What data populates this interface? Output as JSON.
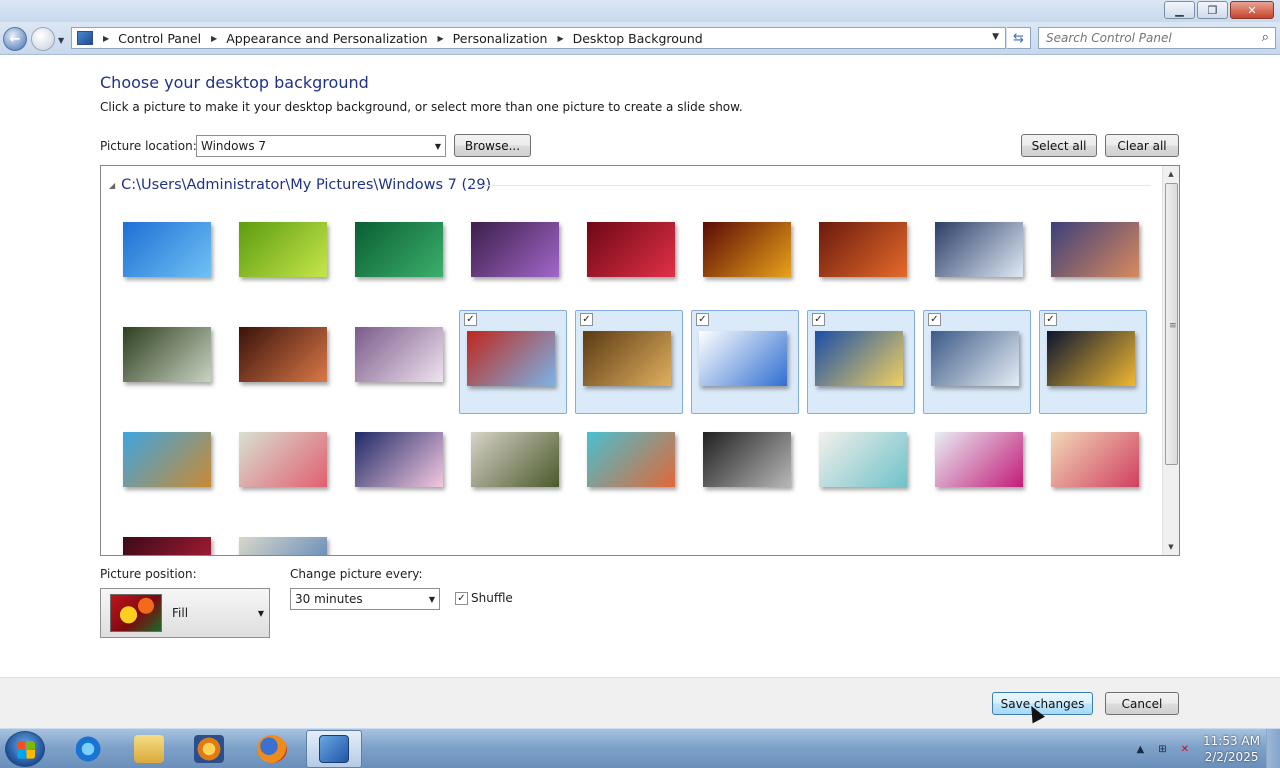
{
  "window": {
    "caption_buttons": [
      "minimize-icon",
      "maximize-icon",
      "close-icon"
    ]
  },
  "nav": {
    "breadcrumbs": [
      "Control Panel",
      "Appearance and Personalization",
      "Personalization",
      "Desktop Background"
    ],
    "search_placeholder": "Search Control Panel"
  },
  "page": {
    "title": "Choose your desktop background",
    "subtitle": "Click a picture to make it your desktop background, or select more than one picture to create a slide show.",
    "picture_location_label": "Picture location:",
    "picture_location_value": "Windows 7",
    "browse_label": "Browse...",
    "select_all_label": "Select all",
    "clear_all_label": "Clear all"
  },
  "gallery": {
    "group_header": "C:\\Users\\Administrator\\My Pictures\\Windows 7 (29)",
    "thumbnails": [
      {
        "subject": "windows-logo",
        "colors": [
          "#1e6fd4",
          "#6fc2f4"
        ],
        "selected": false
      },
      {
        "subject": "green-leaves",
        "colors": [
          "#5c9c10",
          "#c6e64a"
        ],
        "selected": false
      },
      {
        "subject": "green-plant",
        "colors": [
          "#0b5e33",
          "#3ab06a"
        ],
        "selected": false
      },
      {
        "subject": "purple-thistle",
        "colors": [
          "#3a1f4a",
          "#a366c9"
        ],
        "selected": false
      },
      {
        "subject": "red-dahlia",
        "colors": [
          "#6e0814",
          "#e13048"
        ],
        "selected": false
      },
      {
        "subject": "autumn-leaves",
        "colors": [
          "#5a0a06",
          "#e8a21a"
        ],
        "selected": false
      },
      {
        "subject": "canyon",
        "colors": [
          "#6b1a0d",
          "#e46a2a"
        ],
        "selected": false
      },
      {
        "subject": "ice-lake",
        "colors": [
          "#2c3e66",
          "#dfe9f5"
        ],
        "selected": false
      },
      {
        "subject": "rocky-coast",
        "colors": [
          "#3b3f7a",
          "#d98a5e"
        ],
        "selected": false
      },
      {
        "subject": "waterfall",
        "colors": [
          "#2e3f1f",
          "#c8d3c2"
        ],
        "selected": false
      },
      {
        "subject": "rock-arch",
        "colors": [
          "#3a120a",
          "#d97848"
        ],
        "selected": false
      },
      {
        "subject": "lavender-field",
        "colors": [
          "#7a5a8a",
          "#efe3ee"
        ],
        "selected": false
      },
      {
        "subject": "tower-sunset",
        "colors": [
          "#c0261c",
          "#7ab4e8"
        ],
        "selected": true
      },
      {
        "subject": "wood-curves",
        "colors": [
          "#5a3a12",
          "#e0b060"
        ],
        "selected": true
      },
      {
        "subject": "white-building",
        "colors": [
          "#ffffff",
          "#2f6fd0"
        ],
        "selected": true
      },
      {
        "subject": "glass-roof",
        "colors": [
          "#1a4ea8",
          "#f0d060"
        ],
        "selected": true
      },
      {
        "subject": "dotted-facade",
        "colors": [
          "#3b5a86",
          "#e6edf5"
        ],
        "selected": true
      },
      {
        "subject": "bridge-night",
        "colors": [
          "#0b1530",
          "#f0b830"
        ],
        "selected": true
      },
      {
        "subject": "flying-island",
        "colors": [
          "#3da6e0",
          "#c98a32"
        ],
        "selected": false
      },
      {
        "subject": "floral-art",
        "colors": [
          "#d8e0d2",
          "#e06070"
        ],
        "selected": false
      },
      {
        "subject": "cartoon-face",
        "colors": [
          "#1e2a66",
          "#f4c8e0"
        ],
        "selected": false
      },
      {
        "subject": "robot-figure",
        "colors": [
          "#d8d2c8",
          "#4a5a2a"
        ],
        "selected": false
      },
      {
        "subject": "whimsical-town",
        "colors": [
          "#48c0d0",
          "#e06838"
        ],
        "selected": false
      },
      {
        "subject": "gray-creatures",
        "colors": [
          "#202020",
          "#b8b8b8"
        ],
        "selected": false
      },
      {
        "subject": "pastel-tree",
        "colors": [
          "#f2f0ec",
          "#6fc2c8"
        ],
        "selected": false
      },
      {
        "subject": "crystal-flowers",
        "colors": [
          "#e8eef4",
          "#c21c78"
        ],
        "selected": false
      },
      {
        "subject": "fantasy-bloom",
        "colors": [
          "#f2d8b8",
          "#d04060"
        ],
        "selected": false
      },
      {
        "subject": "dark-bloom",
        "colors": [
          "#3a0a1a",
          "#c0203a"
        ],
        "selected": false
      },
      {
        "subject": "blue-flowers",
        "colors": [
          "#d8d8c8",
          "#4a78b8"
        ],
        "selected": false
      }
    ]
  },
  "controls": {
    "position_label": "Picture position:",
    "position_value": "Fill",
    "change_label": "Change picture every:",
    "change_value": "30 minutes",
    "shuffle_label": "Shuffle",
    "shuffle_checked": true
  },
  "footer": {
    "save_label": "Save changes",
    "cancel_label": "Cancel"
  },
  "taskbar": {
    "apps": [
      "internet-explorer-icon",
      "file-explorer-icon",
      "media-player-icon",
      "firefox-icon",
      "control-panel-icon"
    ],
    "active_app": "control-panel-icon",
    "time": "11:53 AM",
    "date": "2/2/2025"
  }
}
